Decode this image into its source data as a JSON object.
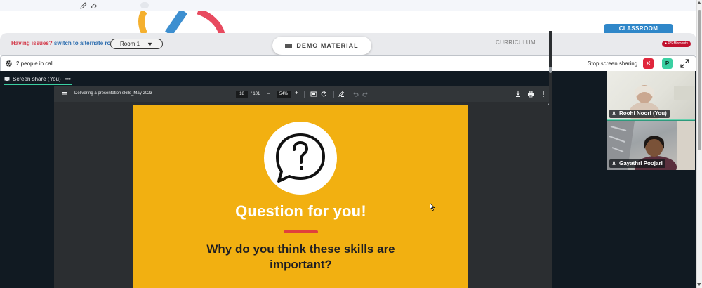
{
  "toolbar": {
    "pencil_icon": "pencil-icon",
    "eraser_icon": "eraser-icon"
  },
  "nav": {
    "issue_prefix": "Having issues?",
    "issue_link": "switch to alternate room",
    "room_selected": "Room 1",
    "demo_material": "DEMO MATERIAL",
    "curriculum": "CURRICULUM",
    "classroom": "CLASSROOM",
    "moments": "PS Moments"
  },
  "call": {
    "people_count": "2 people in call",
    "stop_sharing": "Stop screen sharing",
    "stop_x": "✕",
    "p_button": "P",
    "share_tab": "Screen share (You)",
    "share_more": "•••"
  },
  "pdf": {
    "title": "Delivering a presentation skills_May 2023",
    "page_current": "18",
    "page_total": "/ 101",
    "zoom": "54%",
    "minus": "−",
    "plus": "+"
  },
  "slide": {
    "heading": "Question for you!",
    "body": "Why do you think these skills are important?"
  },
  "participants": [
    {
      "name": "Roohi Noori (You)"
    },
    {
      "name": "Gayathri Poojari"
    }
  ],
  "colors": {
    "slide_bg": "#f2b011",
    "accent_red": "#e0263c",
    "accent_teal": "#3ad0a2",
    "classroom_blue": "#2f87c9",
    "call_bg": "#111a22"
  }
}
